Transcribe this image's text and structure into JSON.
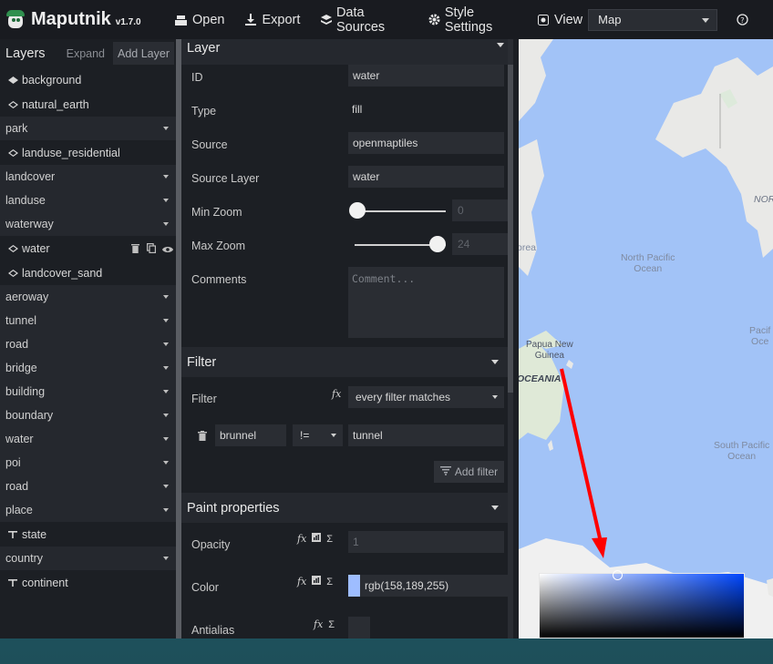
{
  "app": {
    "title": "Maputnik",
    "version": "v1.7.0"
  },
  "toolbar": {
    "open": "Open",
    "export": "Export",
    "data_sources": "Data Sources",
    "style_settings": "Style Settings",
    "view": "View",
    "view_select": "Map",
    "help_icon": "help-icon"
  },
  "layers": {
    "title": "Layers",
    "expand": "Expand",
    "add_layer": "Add Layer",
    "items": [
      {
        "type": "layer",
        "label": "background",
        "icon": "fill-filled-icon"
      },
      {
        "type": "layer",
        "label": "natural_earth",
        "icon": "fill-outline-icon"
      },
      {
        "type": "group",
        "label": "park"
      },
      {
        "type": "layer",
        "label": "landuse_residential",
        "icon": "fill-outline-icon"
      },
      {
        "type": "group",
        "label": "landcover"
      },
      {
        "type": "group",
        "label": "landuse"
      },
      {
        "type": "group",
        "label": "waterway"
      },
      {
        "type": "layer",
        "label": "water",
        "icon": "fill-outline-icon",
        "selected": true
      },
      {
        "type": "layer",
        "label": "landcover_sand",
        "icon": "fill-outline-icon"
      },
      {
        "type": "group",
        "label": "aeroway"
      },
      {
        "type": "group",
        "label": "tunnel"
      },
      {
        "type": "group",
        "label": "road"
      },
      {
        "type": "group",
        "label": "bridge"
      },
      {
        "type": "group",
        "label": "building"
      },
      {
        "type": "group",
        "label": "boundary"
      },
      {
        "type": "group",
        "label": "water"
      },
      {
        "type": "group",
        "label": "poi"
      },
      {
        "type": "group",
        "label": "road"
      },
      {
        "type": "group",
        "label": "place"
      },
      {
        "type": "layer",
        "label": "state",
        "icon": "symbol-icon"
      },
      {
        "type": "group",
        "label": "country"
      },
      {
        "type": "layer",
        "label": "continent",
        "icon": "symbol-icon"
      }
    ]
  },
  "editor": {
    "layer_section": "Layer",
    "id_label": "ID",
    "id_value": "water",
    "type_label": "Type",
    "type_value": "fill",
    "source_label": "Source",
    "source_value": "openmaptiles",
    "source_layer_label": "Source Layer",
    "source_layer_value": "water",
    "min_zoom_label": "Min Zoom",
    "min_zoom_value": "0",
    "min_zoom_level": 0,
    "max_zoom_label": "Max Zoom",
    "max_zoom_value": "24",
    "max_zoom_level": 24,
    "comments_label": "Comments",
    "comments_placeholder": "Comment...",
    "filter_section": "Filter",
    "filter_label": "Filter",
    "filter_mode": "every filter matches",
    "filter_key": "brunnel",
    "filter_op": "!=",
    "filter_value": "tunnel",
    "add_filter": "Add filter",
    "paint_section": "Paint properties",
    "opacity_label": "Opacity",
    "opacity_value": "1",
    "color_label": "Color",
    "color_value": "rgb(158,189,255)",
    "antialias_label": "Antialias"
  },
  "map": {
    "labels": {
      "korea": "orea",
      "north_pacific": "North Pacific\nOcean",
      "papua": "Papua New\nGuinea",
      "oceania": "OCEANIA",
      "south_pacific": "South Pacific\nOcean",
      "north_america_partial": "NOR",
      "pacific_partial": "Pacif\nOce"
    }
  },
  "colors": {
    "fill_color": "#9ebdff",
    "map_water": "#a2c3f7",
    "annotation_arrow": "#ff0000"
  }
}
